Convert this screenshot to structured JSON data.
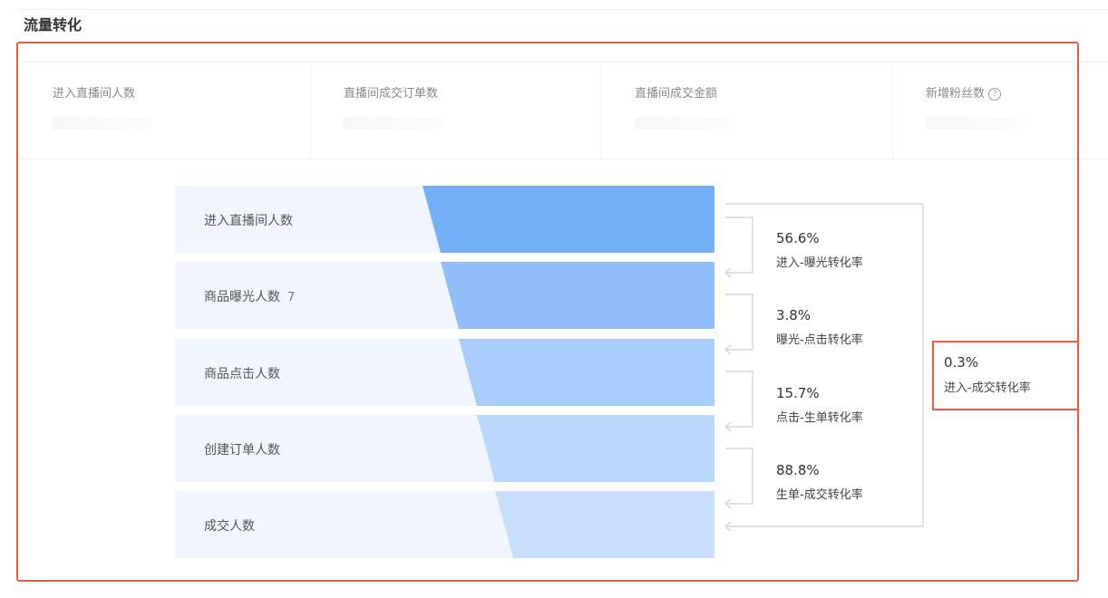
{
  "section_title": "流量转化",
  "metrics": [
    {
      "label": "进入直播间人数",
      "has_help": false
    },
    {
      "label": "直播间成交订单数",
      "has_help": false
    },
    {
      "label": "直播间成交金额",
      "has_help": false
    },
    {
      "label": "新增粉丝数",
      "has_help": true,
      "help_icon": "question-circle-icon"
    }
  ],
  "funnel": {
    "stages": [
      {
        "label": "进入直播间人数",
        "mark": "",
        "color": "#74b0f8"
      },
      {
        "label": "商品曝光人数",
        "mark": "7",
        "color": "#8fbef9"
      },
      {
        "label": "商品点击人数",
        "mark": "",
        "color": "#a8cdfb"
      },
      {
        "label": "创建订单人数",
        "mark": "",
        "color": "#bad7fc"
      },
      {
        "label": "成交人数",
        "mark": "",
        "color": "#c9e0fd"
      }
    ],
    "rates": [
      {
        "pct": "56.6%",
        "name": "进入-曝光转化率"
      },
      {
        "pct": "3.8%",
        "name": "曝光-点击转化率"
      },
      {
        "pct": "15.7%",
        "name": "点击-生单转化率"
      },
      {
        "pct": "88.8%",
        "name": "生单-成交转化率"
      }
    ],
    "total_rate": {
      "pct": "0.3%",
      "name": "进入-成交转化率"
    }
  },
  "colors": {
    "highlight_border": "#e85b45",
    "row_background": "#f1f5fd",
    "connector": "#d6d6d6"
  }
}
